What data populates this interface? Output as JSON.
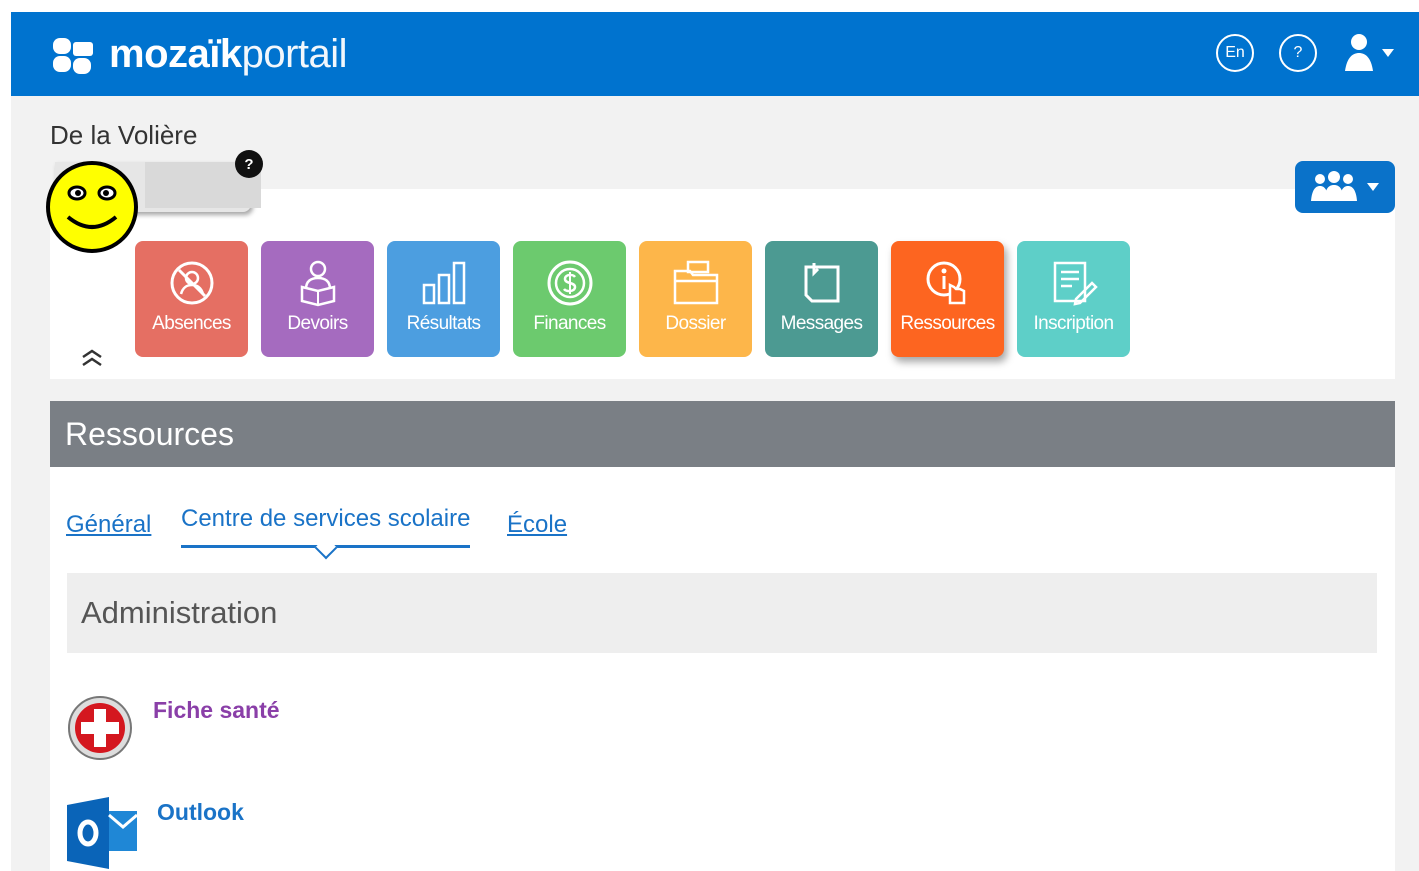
{
  "header": {
    "logo_bold": "mozaïk",
    "logo_light": "portail",
    "lang_label": "En",
    "help_label": "?",
    "bg_color": "#0073cf"
  },
  "school": {
    "name": "De la Volière"
  },
  "student": {
    "help_badge": "?"
  },
  "tiles": [
    {
      "label": "Absences",
      "color": "#e56f63",
      "icon": "absences-icon"
    },
    {
      "label": "Devoirs",
      "color": "#a56bbf",
      "icon": "book-reader-icon"
    },
    {
      "label": "Résultats",
      "color": "#4c9ee0",
      "icon": "bar-chart-icon"
    },
    {
      "label": "Finances",
      "color": "#6cca6e",
      "icon": "dollar-coin-icon"
    },
    {
      "label": "Dossier",
      "color": "#fdb64a",
      "icon": "folder-icon"
    },
    {
      "label": "Messages",
      "color": "#4c9a92",
      "icon": "note-icon"
    },
    {
      "label": "Ressources",
      "color": "#fd6520",
      "icon": "info-hand-icon",
      "active": true
    },
    {
      "label": "Inscription",
      "color": "#5ecfc8",
      "icon": "form-edit-icon"
    }
  ],
  "section": {
    "title": "Ressources"
  },
  "tabs": [
    {
      "label": "Général"
    },
    {
      "label": "Centre de services scolaire",
      "selected": true
    },
    {
      "label": "École"
    }
  ],
  "category": {
    "title": "Administration"
  },
  "resources": [
    {
      "name": "Fiche santé",
      "color": "#8a3fa8",
      "icon": "health-cross-icon"
    },
    {
      "name": "Outlook",
      "color": "#1a73c7",
      "icon": "outlook-icon"
    }
  ]
}
